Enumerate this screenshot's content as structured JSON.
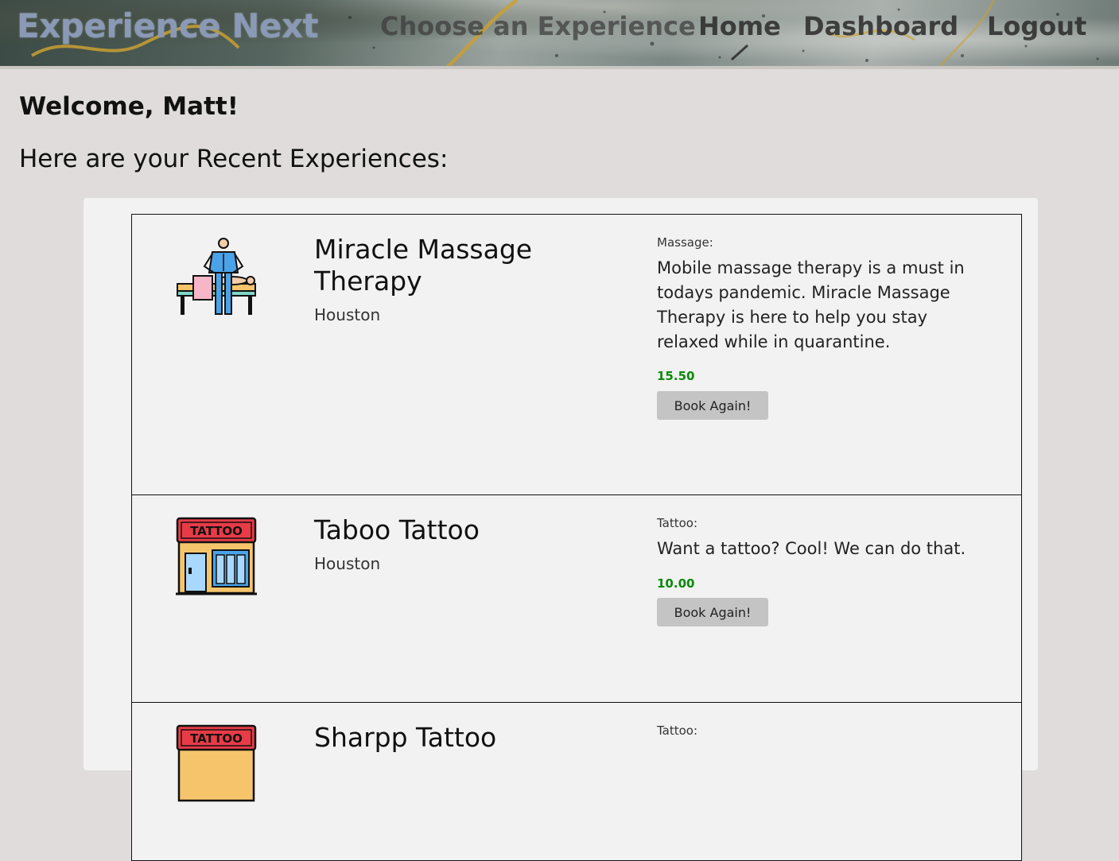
{
  "header": {
    "brand": "Experience Next",
    "nav": {
      "choose": "Choose an Experience",
      "home": "Home",
      "dashboard": "Dashboard",
      "logout": "Logout"
    }
  },
  "main": {
    "welcome": "Welcome, Matt!",
    "recent_title": "Here are your Recent Experiences:"
  },
  "experiences": [
    {
      "name": "Miracle Massage Therapy",
      "city": "Houston",
      "category": "Massage:",
      "description": "Mobile massage therapy is a must in todays pandemic. Miracle Massage Therapy is here to help you stay relaxed while in quarantine.",
      "price": "15.50",
      "button": "Book Again!",
      "icon": "massage-icon"
    },
    {
      "name": "Taboo Tattoo",
      "city": "Houston",
      "category": "Tattoo:",
      "description": "Want a tattoo? Cool! We can do that.",
      "price": "10.00",
      "button": "Book Again!",
      "icon": "tattoo-shop-icon"
    },
    {
      "name": "Sharpp Tattoo",
      "category": "Tattoo:",
      "icon": "tattoo-shop-icon"
    }
  ],
  "icon_labels": {
    "tattoo_sign": "TATTOO"
  },
  "colors": {
    "brand": "#8a99b5",
    "price": "#0a8a0a",
    "button_bg": "#c4c4c4",
    "page_bg": "#dfdcdb",
    "panel_bg": "#f2f2f2"
  }
}
